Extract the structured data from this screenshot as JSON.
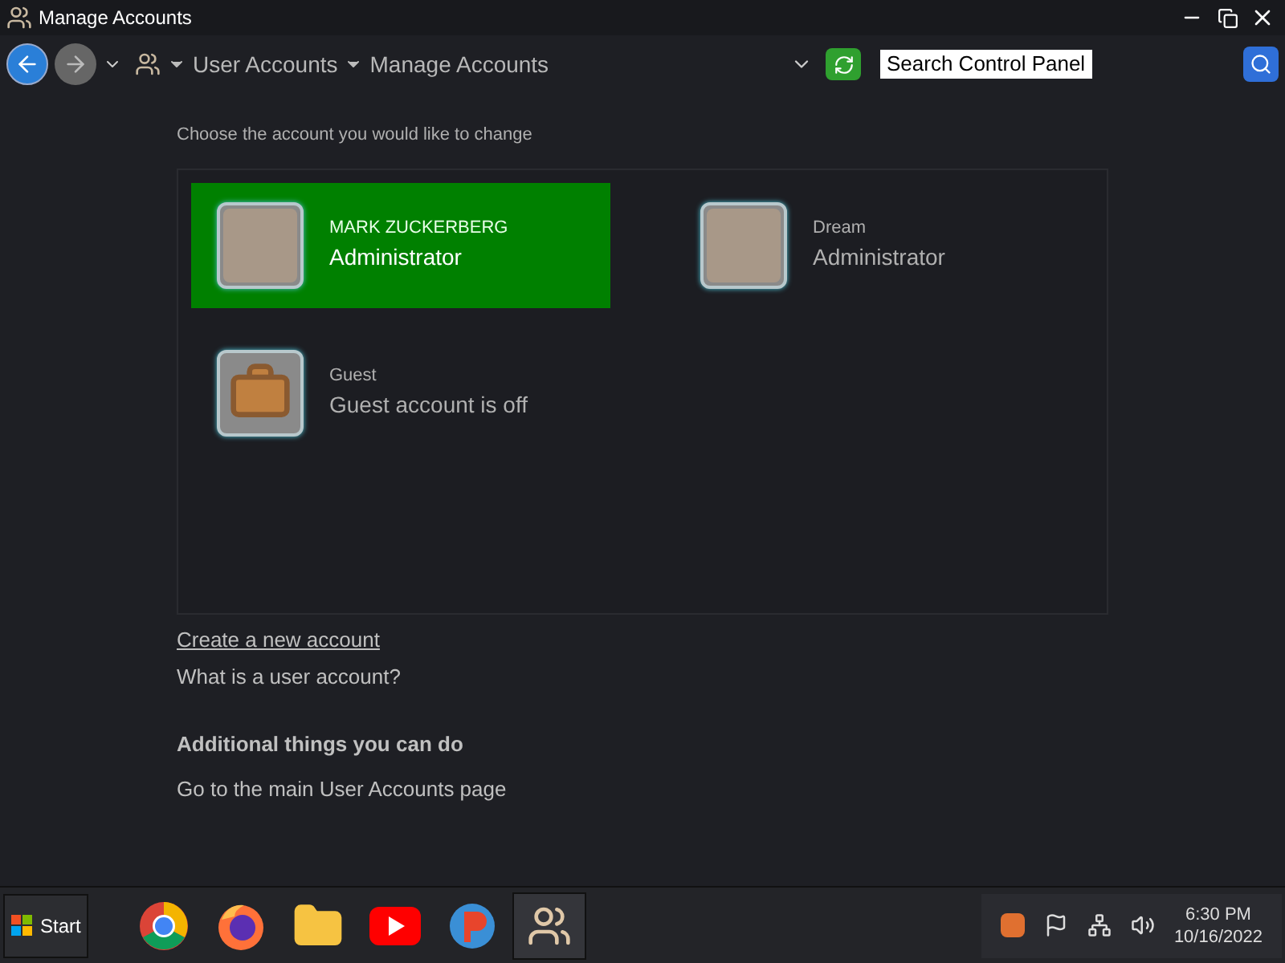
{
  "window": {
    "title": "Manage Accounts"
  },
  "breadcrumb": [
    "User Accounts",
    "Manage Accounts"
  ],
  "search": {
    "placeholder": "Search Control Panel"
  },
  "prompt": "Choose the account you would like to change",
  "accounts": [
    {
      "name": "MARK ZUCKERBERG",
      "role": "Administrator",
      "selected": true,
      "kind": "photo"
    },
    {
      "name": "Dream",
      "role": "Administrator",
      "selected": false,
      "kind": "photo"
    },
    {
      "name": "Guest",
      "role": "Guest account is off",
      "selected": false,
      "kind": "suitcase"
    }
  ],
  "links": [
    "Create a new account",
    "What is a user account?"
  ],
  "additional": {
    "heading": "Additional things you can do",
    "links": [
      "Go to the main User Accounts page"
    ]
  },
  "taskbar": {
    "start": "Start",
    "apps": [
      {
        "kind": "chrome",
        "selected": false
      },
      {
        "kind": "firefox",
        "selected": false
      },
      {
        "kind": "folder",
        "selected": false
      },
      {
        "kind": "youtube",
        "selected": false
      },
      {
        "kind": "p",
        "selected": false
      },
      {
        "kind": "users",
        "selected": true
      }
    ],
    "time": "6:30 PM",
    "date": "10/16/2022"
  }
}
